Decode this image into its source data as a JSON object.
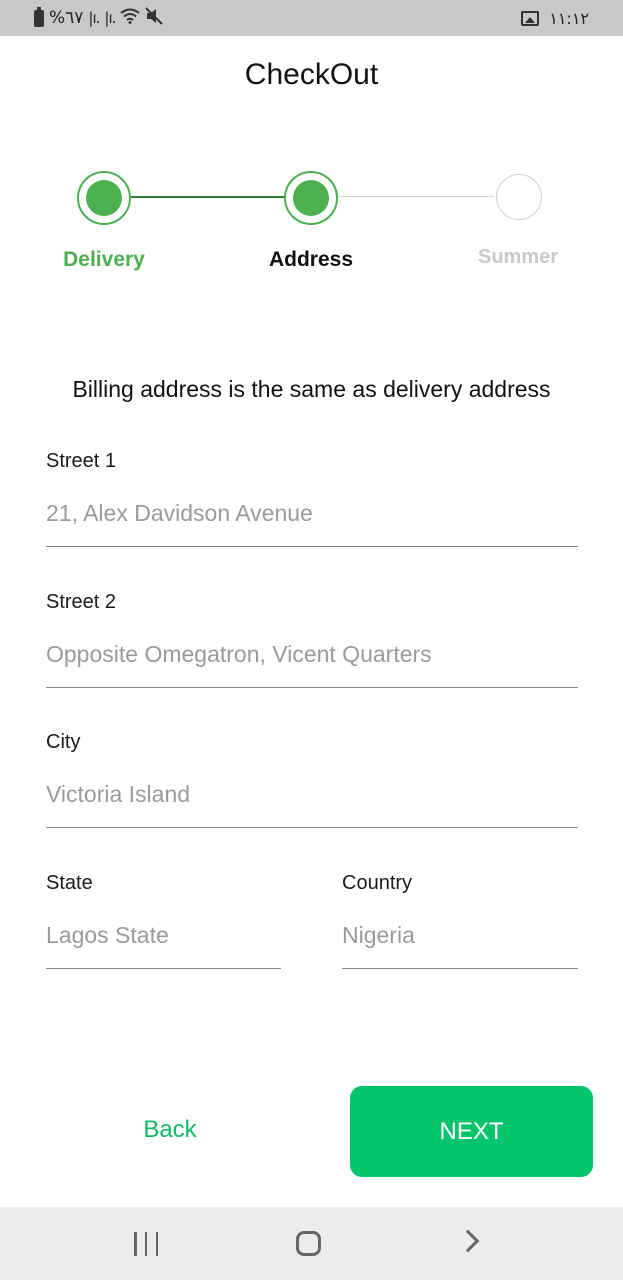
{
  "status_bar": {
    "battery_text": "%٦٧",
    "time": "١١:١٢",
    "icons": [
      "battery-icon",
      "signal-icon",
      "signal-icon",
      "wifi-icon",
      "mute-icon",
      "gallery-icon"
    ]
  },
  "header": {
    "title": "CheckOut"
  },
  "stepper": {
    "steps": [
      {
        "label": "Delivery",
        "state": "completed"
      },
      {
        "label": "Address",
        "state": "active"
      },
      {
        "label": "Summer",
        "state": "pending"
      }
    ],
    "colors": {
      "active": "#4caf50",
      "pending": "#c9c9c9"
    }
  },
  "billing_note": "Billing address is the same as delivery address",
  "form": {
    "street1": {
      "label": "Street 1",
      "value": "21, Alex Davidson Avenue"
    },
    "street2": {
      "label": "Street 2",
      "value": "Opposite Omegatron, Vicent Quarters"
    },
    "city": {
      "label": "City",
      "value": "Victoria Island"
    },
    "state": {
      "label": "State",
      "value": "Lagos State"
    },
    "country": {
      "label": "Country",
      "value": "Nigeria"
    }
  },
  "actions": {
    "back_label": "Back",
    "next_label": "NEXT",
    "accent": "#05c46b"
  },
  "nav_bar": {
    "icons": [
      "recents-icon",
      "home-icon",
      "back-chevron-icon"
    ]
  }
}
